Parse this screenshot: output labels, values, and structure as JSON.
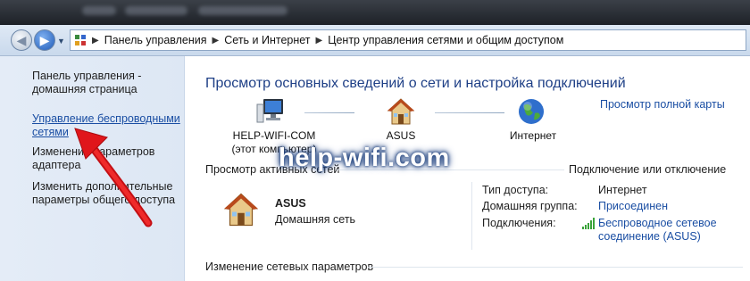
{
  "address_bar": {
    "breadcrumbs": [
      "Панель управления",
      "Сеть и Интернет",
      "Центр управления сетями и общим доступом"
    ]
  },
  "sidebar": {
    "items": [
      {
        "label_line1": "Панель управления -",
        "label_line2": "домашняя страница"
      },
      {
        "label_line1": "Управление беспроводными",
        "label_line2": "сетями"
      },
      {
        "label_line1": "Изменение параметров",
        "label_line2": "адаптера"
      },
      {
        "label_line1": "Изменить дополнительные",
        "label_line2": "параметры общего доступа"
      }
    ]
  },
  "main": {
    "title": "Просмотр основных сведений о сети и настройка подключений",
    "full_map_link": "Просмотр полной карты",
    "map_nodes": [
      {
        "label": "HELP-WIFI-COM",
        "sublabel": "(этот компьютер)",
        "icon": "computer-icon"
      },
      {
        "label": "ASUS",
        "icon": "house-icon"
      },
      {
        "label": "Интернет",
        "icon": "globe-icon"
      }
    ],
    "active_networks_label": "Просмотр активных сетей",
    "connect_disconnect_link": "Подключение или отключение",
    "network": {
      "name": "ASUS",
      "type_link": "Домашняя сеть",
      "access_type_label": "Тип доступа:",
      "access_type_value": "Интернет",
      "homegroup_label": "Домашняя группа:",
      "homegroup_value": "Присоединен",
      "connections_label": "Подключения:",
      "connections_value_line1": "Беспроводное сетевое",
      "connections_value_line2": "соединение (ASUS)"
    },
    "change_settings_label": "Изменение сетевых параметров"
  },
  "watermark": "help-wifi.com",
  "colors": {
    "link": "#1a4ea3",
    "title": "#1e3f86",
    "arrow": "#e0161b",
    "sidebar_bg": "#e4ecf7"
  }
}
